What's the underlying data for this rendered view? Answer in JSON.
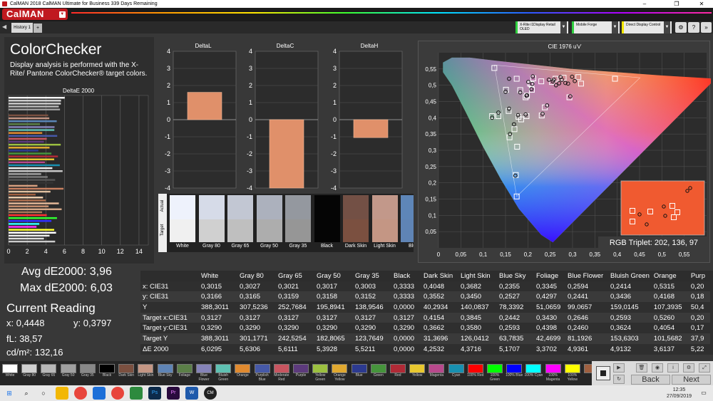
{
  "window": {
    "title": "CalMAN 2018 CalMAN Ultimate for Business 339 Days Remaining",
    "minimize": "–",
    "restore": "❐",
    "close": "✕"
  },
  "app": {
    "logo": "CalMAN"
  },
  "tabs": [
    {
      "label": "History 1"
    }
  ],
  "devices": [
    {
      "label": "X-Rite i1Display Retail",
      "sub": "OLED",
      "color": "#2fd13f"
    },
    {
      "label": "Mobile Forge",
      "sub": "",
      "color": "#2fd13f"
    },
    {
      "label": "Direct Display Control",
      "sub": "",
      "color": "#f2e600"
    }
  ],
  "page": {
    "title": "ColorChecker",
    "description": "Display analysis is performed with the X-Rite/ Pantone ColorChecker® target colors."
  },
  "colors": {
    "accent": "#c0191f",
    "bar": "#e0906a",
    "bg": "#383838"
  },
  "chart_data": [
    {
      "type": "bar",
      "title": "DeltaE 2000",
      "orientation": "horizontal",
      "xlim": [
        0,
        15
      ],
      "xticks": [
        "0",
        "2",
        "4",
        "6",
        "8",
        "10",
        "12",
        "14"
      ],
      "values": [
        6.0295,
        5.6306,
        5.6111,
        5.3928,
        5.5211,
        0.0,
        4.2532,
        4.3716,
        5.1707,
        3.3702,
        4.9361,
        4.9132,
        3.6137,
        5.22,
        4.1,
        3.8,
        5.6,
        4.4,
        3.2,
        4.6,
        5.3,
        4.9,
        3.9,
        5.5,
        4.7,
        5.8,
        3.5,
        4.2,
        5.0,
        4.8,
        3.1,
        5.9,
        4.5,
        2.9,
        3.7,
        4.0,
        5.4,
        4.3,
        5.7,
        3.6,
        4.1,
        5.2,
        4.6,
        3.3,
        3.0,
        4.9,
        5.1,
        4.4,
        3.8,
        5.0
      ],
      "bar_colors": [
        "#ffffff",
        "#d5d5d5",
        "#cfcfcf",
        "#b9b9b9",
        "#9f9f9f",
        "#111111",
        "#7a5040",
        "#c49584",
        "#5b86b8",
        "#5b7f48",
        "#8583b8",
        "#5fc0b2",
        "#e08a30",
        "#4659a8",
        "#c85560",
        "#5c3a7c",
        "#9cc040",
        "#e0a830",
        "#2c3a90",
        "#46943c",
        "#b02a36",
        "#e8c830",
        "#b8498c",
        "#1890b0",
        "#f0f0f0",
        "#c8c8c8",
        "#a0a0a0",
        "#7a7a7a",
        "#555555",
        "#333333",
        "#d8a080",
        "#c88060",
        "#e0c0a0",
        "#a06040",
        "#f0d0b0",
        "#b07050",
        "#e4b898",
        "#c89070",
        "#d4a888",
        "#a87858",
        "#ff3030",
        "#30ff30",
        "#3030ff",
        "#30ffff",
        "#ff30ff",
        "#ffff30",
        "#ffffff",
        "#eeeeee",
        "#dddddd",
        "#cccccc"
      ]
    },
    {
      "type": "bar",
      "title": "DeltaL",
      "ylim": [
        -4,
        4
      ],
      "yticks": [
        "4",
        "3",
        "2",
        "1",
        "0",
        "-1",
        "-2",
        "-3",
        "-4"
      ],
      "values": [
        1.6
      ]
    },
    {
      "type": "bar",
      "title": "DeltaC",
      "ylim": [
        -4,
        4
      ],
      "yticks": [
        "4",
        "3",
        "2",
        "1",
        "0",
        "-1",
        "-2",
        "-3",
        "-4"
      ],
      "values": [
        -4.0
      ]
    },
    {
      "type": "bar",
      "title": "DeltaH",
      "ylim": [
        -4,
        4
      ],
      "yticks": [
        "4",
        "3",
        "2",
        "1",
        "0",
        "-1",
        "-2",
        "-3",
        "-4"
      ],
      "values": [
        -1.05
      ]
    },
    {
      "type": "scatter",
      "title": "CIE 1976 u'v'",
      "xlim": [
        0,
        0.6
      ],
      "ylim": [
        0,
        0.6
      ],
      "xticks": [
        "0",
        "0,05",
        "0,1",
        "0,15",
        "0,2",
        "0,25",
        "0,3",
        "0,35",
        "0,4",
        "0,45",
        "0,5",
        "0,55"
      ],
      "yticks": [
        "0,55",
        "0,5",
        "0,45",
        "0,4",
        "0,35",
        "0,3",
        "0,25",
        "0,2",
        "0,15",
        "0,1",
        "0,05"
      ],
      "gamut_triangle": [
        [
          0.451,
          0.523
        ],
        [
          0.125,
          0.562
        ],
        [
          0.175,
          0.158
        ]
      ],
      "targets": [
        [
          0.198,
          0.468
        ],
        [
          0.209,
          0.486
        ],
        [
          0.183,
          0.485
        ],
        [
          0.157,
          0.421
        ],
        [
          0.238,
          0.432
        ],
        [
          0.175,
          0.52
        ],
        [
          0.212,
          0.521
        ],
        [
          0.262,
          0.52
        ],
        [
          0.151,
          0.486
        ],
        [
          0.293,
          0.463
        ],
        [
          0.17,
          0.365
        ],
        [
          0.159,
          0.34
        ],
        [
          0.197,
          0.405
        ],
        [
          0.205,
          0.505
        ],
        [
          0.12,
          0.405
        ],
        [
          0.231,
          0.407
        ],
        [
          0.28,
          0.523
        ],
        [
          0.254,
          0.51
        ],
        [
          0.134,
          0.405
        ],
        [
          0.208,
          0.503
        ],
        [
          0.173,
          0.224
        ],
        [
          0.179,
          0.403
        ],
        [
          0.319,
          0.505
        ],
        [
          0.195,
          0.463
        ],
        [
          0.313,
          0.525
        ],
        [
          0.185,
          0.395
        ],
        [
          0.125,
          0.553
        ],
        [
          0.23,
          0.512
        ],
        [
          0.395,
          0.52
        ],
        [
          0.176,
          0.311
        ],
        [
          0.175,
          0.158
        ]
      ],
      "measured": [
        [
          0.198,
          0.469
        ],
        [
          0.208,
          0.488
        ],
        [
          0.183,
          0.478
        ],
        [
          0.158,
          0.428
        ],
        [
          0.243,
          0.438
        ],
        [
          0.158,
          0.52
        ],
        [
          0.211,
          0.527
        ],
        [
          0.256,
          0.512
        ],
        [
          0.15,
          0.48
        ],
        [
          0.295,
          0.466
        ],
        [
          0.169,
          0.38
        ],
        [
          0.16,
          0.35
        ],
        [
          0.195,
          0.41
        ],
        [
          0.201,
          0.51
        ],
        [
          0.12,
          0.4
        ],
        [
          0.233,
          0.412
        ],
        [
          0.273,
          0.525
        ],
        [
          0.27,
          0.506
        ],
        [
          0.134,
          0.416
        ],
        [
          0.21,
          0.504
        ],
        [
          0.172,
          0.222
        ],
        [
          0.178,
          0.408
        ],
        [
          0.299,
          0.526
        ],
        [
          0.197,
          0.468
        ],
        [
          0.284,
          0.507
        ],
        [
          0.276,
          0.517
        ],
        [
          0.247,
          0.517
        ],
        [
          0.263,
          0.5
        ],
        [
          0.258,
          0.517
        ],
        [
          0.29,
          0.505
        ],
        [
          0.305,
          0.513
        ]
      ]
    }
  ],
  "swatches": [
    {
      "label": "White",
      "actual": "#eef2fc",
      "target": "#f0f0f0"
    },
    {
      "label": "Gray 80",
      "actual": "#d6dbe8",
      "target": "#d0d0d0"
    },
    {
      "label": "Gray 65",
      "actual": "#c2c7d3",
      "target": "#bfbfbf"
    },
    {
      "label": "Gray 50",
      "actual": "#acb1bd",
      "target": "#adadad"
    },
    {
      "label": "Gray 35",
      "actual": "#94989f",
      "target": "#969696"
    },
    {
      "label": "Black",
      "actual": "#050505",
      "target": "#050505"
    },
    {
      "label": "Dark Skin",
      "actual": "#735045",
      "target": "#7b5040"
    },
    {
      "label": "Light Skin",
      "actual": "#c2988a",
      "target": "#c49684"
    },
    {
      "label": "Blue",
      "actual": "#5e86b8",
      "target": "#5f84b5"
    }
  ],
  "swatch_axis": {
    "actual": "Actual",
    "target": "Target"
  },
  "cie_inset": {
    "label": "RGB Triplet: 202, 136, 97"
  },
  "stats": {
    "avg": "Avg dE2000: 3,96",
    "max": "Max dE2000: 6,03",
    "current": "Current Reading",
    "x": "x: 0,4448",
    "y": "y: 0,3797",
    "fl": "fL: 38,57",
    "cd": "cd/m²: 132,16"
  },
  "table": {
    "columns": [
      "",
      "White",
      "Gray 80",
      "Gray 65",
      "Gray 50",
      "Gray 35",
      "Black",
      "Dark Skin",
      "Light Skin",
      "Blue Sky",
      "Foliage",
      "Blue Flower",
      "Bluish Green",
      "Orange",
      "Purp"
    ],
    "rows": [
      [
        "x: CIE31",
        "0,3015",
        "0,3027",
        "0,3021",
        "0,3017",
        "0,3003",
        "0,3333",
        "0,4048",
        "0,3682",
        "0,2355",
        "0,3345",
        "0,2594",
        "0,2414",
        "0,5315",
        "0,20"
      ],
      [
        "y: CIE31",
        "0,3166",
        "0,3165",
        "0,3159",
        "0,3158",
        "0,3152",
        "0,3333",
        "0,3552",
        "0,3450",
        "0,2527",
        "0,4297",
        "0,2441",
        "0,3436",
        "0,4168",
        "0,18"
      ],
      [
        "Y",
        "388,3011",
        "307,5236",
        "252,7684",
        "195,8941",
        "138,9546",
        "0,0000",
        "40,2934",
        "140,0837",
        "78,3392",
        "51,0659",
        "99,0657",
        "159,0145",
        "107,3935",
        "50,4"
      ],
      [
        "Target x:CIE31",
        "0,3127",
        "0,3127",
        "0,3127",
        "0,3127",
        "0,3127",
        "0,3127",
        "0,4154",
        "0,3845",
        "0,2442",
        "0,3430",
        "0,2646",
        "0,2593",
        "0,5260",
        "0,20"
      ],
      [
        "Target y:CIE31",
        "0,3290",
        "0,3290",
        "0,3290",
        "0,3290",
        "0,3290",
        "0,3290",
        "0,3662",
        "0,3580",
        "0,2593",
        "0,4398",
        "0,2460",
        "0,3624",
        "0,4054",
        "0,17"
      ],
      [
        "Target Y",
        "388,3011",
        "301,1771",
        "242,5254",
        "182,8065",
        "123,7649",
        "0,0000",
        "31,3696",
        "126,0412",
        "63,7835",
        "42,4699",
        "81,1926",
        "153,6303",
        "101,5682",
        "37,9"
      ],
      [
        "ΔE 2000",
        "6,0295",
        "5,6306",
        "5,6111",
        "5,3928",
        "5,5211",
        "0,0000",
        "4,2532",
        "4,3716",
        "5,1707",
        "3,3702",
        "4,9361",
        "4,9132",
        "3,6137",
        "5,22"
      ]
    ]
  },
  "palette": [
    {
      "label": "White",
      "color": "#ffffff"
    },
    {
      "label": "Gray 80",
      "color": "#d0d0d0"
    },
    {
      "label": "Gray 65",
      "color": "#b8b8b8"
    },
    {
      "label": "Gray 50",
      "color": "#a0a0a0"
    },
    {
      "label": "Gray 35",
      "color": "#888888"
    },
    {
      "label": "Black",
      "color": "#000000"
    },
    {
      "label": "Dark Skin",
      "color": "#7b5040"
    },
    {
      "label": "Light Skin",
      "color": "#c49684"
    },
    {
      "label": "Blue Sky",
      "color": "#5f84b5"
    },
    {
      "label": "Foliage",
      "color": "#5b7f48"
    },
    {
      "label": "Blue Flower",
      "color": "#8583b8"
    },
    {
      "label": "Bluish Green",
      "color": "#5fc0b2"
    },
    {
      "label": "Orange",
      "color": "#e08a30"
    },
    {
      "label": "Purplish Blue",
      "color": "#4659a8"
    },
    {
      "label": "Moderate Red",
      "color": "#c85560"
    },
    {
      "label": "Purple",
      "color": "#5c3a7c"
    },
    {
      "label": "Yellow Green",
      "color": "#9cc040"
    },
    {
      "label": "Orange Yellow",
      "color": "#e0a830"
    },
    {
      "label": "Blue",
      "color": "#2c3a90"
    },
    {
      "label": "Green",
      "color": "#46943c"
    },
    {
      "label": "Red",
      "color": "#b02a36"
    },
    {
      "label": "Yellow",
      "color": "#e8c830"
    },
    {
      "label": "Magenta",
      "color": "#b8498c"
    },
    {
      "label": "Cyan",
      "color": "#1890b0"
    },
    {
      "label": "100% Red",
      "color": "#ff0000"
    },
    {
      "label": "100% Green",
      "color": "#00ff00"
    },
    {
      "label": "100% Blue",
      "color": "#0000ff"
    },
    {
      "label": "100% Cyan",
      "color": "#00ffff"
    },
    {
      "label": "100% Magenta",
      "color": "#ff00ff"
    },
    {
      "label": "100% Yellow",
      "color": "#ffff00"
    },
    {
      "label": "",
      "color": "#a06040"
    }
  ],
  "controls": {
    "back": "Back",
    "next": "Next"
  },
  "taskbar": {
    "time": "12:35",
    "date": "27/09/2019"
  }
}
